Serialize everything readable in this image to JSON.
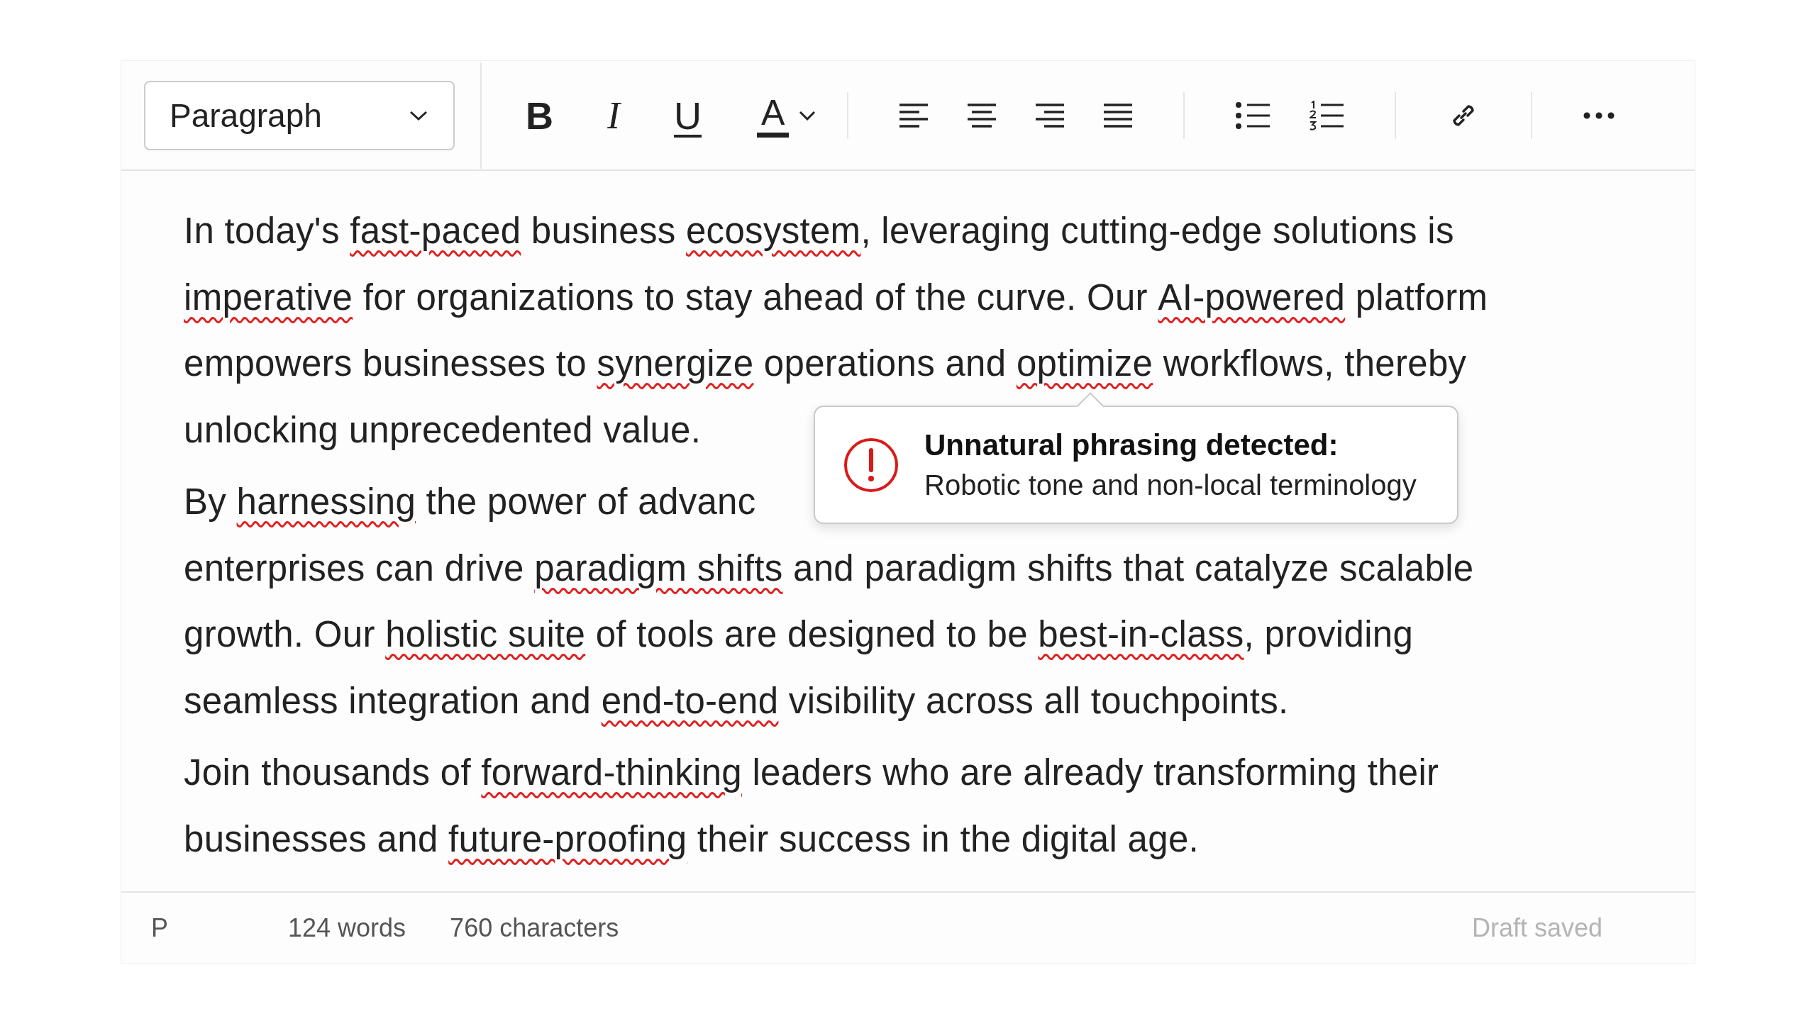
{
  "toolbar": {
    "block_format": "Paragraph",
    "buttons": [
      {
        "kind": "bold",
        "label": "B"
      },
      {
        "kind": "italic",
        "label": "I"
      },
      {
        "kind": "underline",
        "label": "U"
      },
      {
        "kind": "color",
        "label": "A"
      },
      {
        "kind": "divider"
      },
      {
        "kind": "align-left"
      },
      {
        "kind": "align-center"
      },
      {
        "kind": "align-right"
      },
      {
        "kind": "justify"
      },
      {
        "kind": "divider"
      },
      {
        "kind": "bullets"
      },
      {
        "kind": "numbers"
      },
      {
        "kind": "divider"
      },
      {
        "kind": "link"
      },
      {
        "kind": "divider"
      },
      {
        "kind": "more"
      }
    ]
  },
  "paragraphs": [
    {
      "lines": [
        [
          {
            "text": "In today's ",
            "flagged": false
          },
          {
            "text": "fast-paced",
            "flagged": true
          },
          {
            "text": " business ",
            "flagged": false
          },
          {
            "text": "ecosystem",
            "flagged": true
          },
          {
            "text": ", leveraging cutting-edge solutions is",
            "flagged": false
          }
        ],
        [
          {
            "text": "imperative",
            "flagged": true
          },
          {
            "text": " for organizations to stay ahead of the curve. Our ",
            "flagged": false
          },
          {
            "text": "AI-powered",
            "flagged": true
          },
          {
            "text": " platform",
            "flagged": false
          }
        ],
        [
          {
            "text": "empowers businesses to ",
            "flagged": false
          },
          {
            "text": "synergize",
            "flagged": true
          },
          {
            "text": " operations and ",
            "flagged": false
          },
          {
            "text": "optimize",
            "flagged": true
          },
          {
            "text": " workflows, thereby",
            "flagged": false
          }
        ],
        [
          {
            "text": "unlocking unprecedented value.",
            "flagged": false
          }
        ]
      ]
    },
    {
      "lines": [
        [
          {
            "text": "By ",
            "flagged": false
          },
          {
            "text": "harnessing",
            "flagged": true
          },
          {
            "text": " the power of advanc",
            "flagged": false
          }
        ],
        [
          {
            "text": "enterprises can drive ",
            "flagged": false
          },
          {
            "text": "paradigm shifts",
            "flagged": true
          },
          {
            "text": " and paradigm shifts that catalyze scalable",
            "flagged": false
          }
        ],
        [
          {
            "text": "growth. Our ",
            "flagged": false
          },
          {
            "text": "holistic suite",
            "flagged": true
          },
          {
            "text": " of tools are designed to be ",
            "flagged": false
          },
          {
            "text": "best-in-class",
            "flagged": true
          },
          {
            "text": ", providing",
            "flagged": false
          }
        ],
        [
          {
            "text": "seamless integration and ",
            "flagged": false
          },
          {
            "text": "end-to-end",
            "flagged": true
          },
          {
            "text": " visibility across all touchpoints.",
            "flagged": false
          }
        ]
      ]
    },
    {
      "lines": [
        [
          {
            "text": "Join thousands of ",
            "flagged": false
          },
          {
            "text": "forward-thinking",
            "flagged": true
          },
          {
            "text": " leaders who are already transforming their",
            "flagged": false
          }
        ],
        [
          {
            "text": "businesses and ",
            "flagged": false
          },
          {
            "text": "future-proofing",
            "flagged": true
          },
          {
            "text": " their success in the digital age.",
            "flagged": false
          }
        ]
      ]
    }
  ],
  "tooltip": {
    "title": "Unnatural phrasing detected:",
    "message": "Robotic tone and non-local terminology"
  },
  "status_bar": {
    "block": "P",
    "words": "124 words",
    "characters": "760 characters",
    "save_state": "Draft saved"
  }
}
